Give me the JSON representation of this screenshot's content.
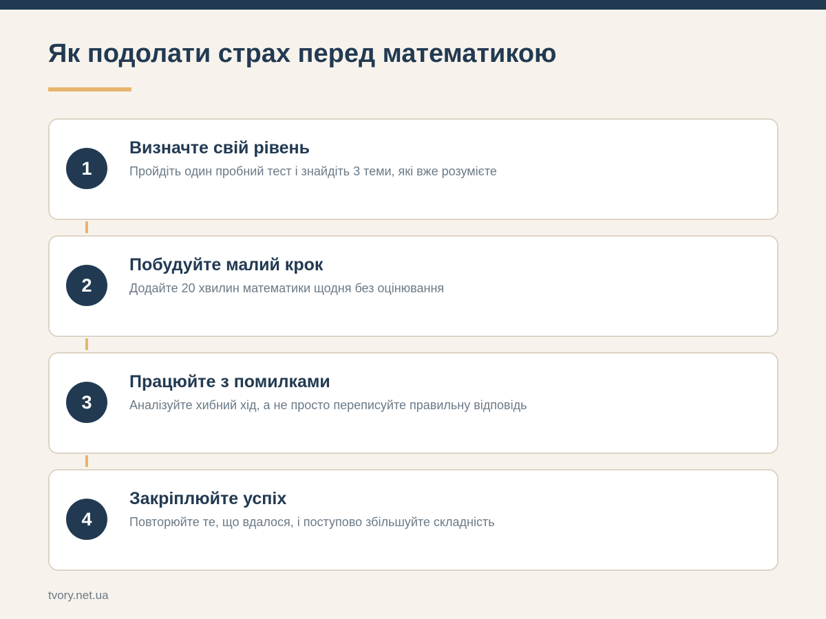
{
  "page": {
    "title": "Як подолати страх перед математикою",
    "source": "tvory.net.ua"
  },
  "colors": {
    "background": "#f7f3ec",
    "primary": "#213a52",
    "accent": "#e8b46c",
    "text_muted": "#6b7a87",
    "card_border": "#ddd4c5"
  },
  "steps": [
    {
      "number": "1",
      "title": "Визначте свій рівень",
      "description": "Пройдіть один пробний тест і знайдіть 3 теми, які вже розумієте"
    },
    {
      "number": "2",
      "title": "Побудуйте малий крок",
      "description": "Додайте 20 хвилин математики щодня без оцінювання"
    },
    {
      "number": "3",
      "title": "Працюйте з помилками",
      "description": "Аналізуйте хибний хід, а не просто переписуйте правильну відповідь"
    },
    {
      "number": "4",
      "title": "Закріплюйте успіх",
      "description": "Повторюйте те, що вдалося, і поступово збільшуйте складність"
    }
  ]
}
